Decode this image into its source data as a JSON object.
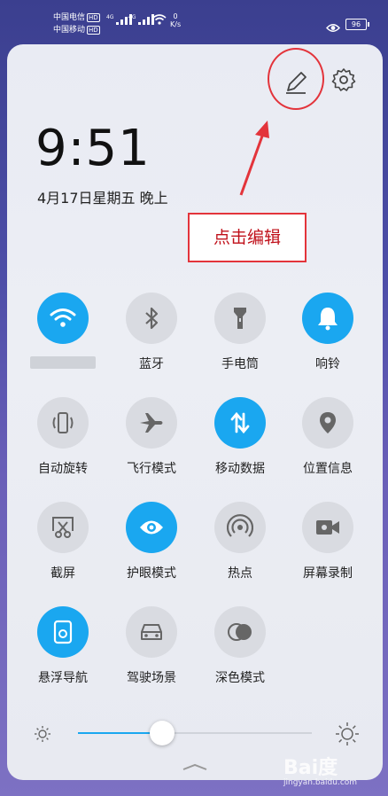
{
  "status_bar": {
    "carrier1": "中国电信",
    "carrier2": "中国移动",
    "hd": "HD",
    "net1": "4G",
    "net2": "4G",
    "speed_value": "0",
    "speed_unit": "K/s",
    "battery": "96"
  },
  "clock": {
    "time": "9:51",
    "date": "4月17日星期五 晚上"
  },
  "callout": {
    "text": "点击编辑"
  },
  "tiles": [
    {
      "label": "",
      "on": true,
      "icon": "wifi-icon"
    },
    {
      "label": "蓝牙",
      "on": false,
      "icon": "bluetooth-icon"
    },
    {
      "label": "手电筒",
      "on": false,
      "icon": "flashlight-icon"
    },
    {
      "label": "响铃",
      "on": true,
      "icon": "bell-icon"
    },
    {
      "label": "自动旋转",
      "on": false,
      "icon": "rotate-icon"
    },
    {
      "label": "飞行模式",
      "on": false,
      "icon": "airplane-icon"
    },
    {
      "label": "移动数据",
      "on": true,
      "icon": "mobile-data-icon"
    },
    {
      "label": "位置信息",
      "on": false,
      "icon": "location-icon"
    },
    {
      "label": "截屏",
      "on": false,
      "icon": "screenshot-icon"
    },
    {
      "label": "护眼模式",
      "on": true,
      "icon": "eye-comfort-icon"
    },
    {
      "label": "热点",
      "on": false,
      "icon": "hotspot-icon"
    },
    {
      "label": "屏幕录制",
      "on": false,
      "icon": "screen-record-icon"
    },
    {
      "label": "悬浮导航",
      "on": true,
      "icon": "floating-nav-icon"
    },
    {
      "label": "驾驶场景",
      "on": false,
      "icon": "car-icon"
    },
    {
      "label": "深色模式",
      "on": false,
      "icon": "dark-mode-icon"
    }
  ],
  "brightness": {
    "level": 0.36
  },
  "watermark": {
    "main": "Bai度",
    "sub": "jingyan.baidu.com"
  },
  "colors": {
    "accent": "#1aa7f0",
    "annotation": "#e3343b"
  }
}
